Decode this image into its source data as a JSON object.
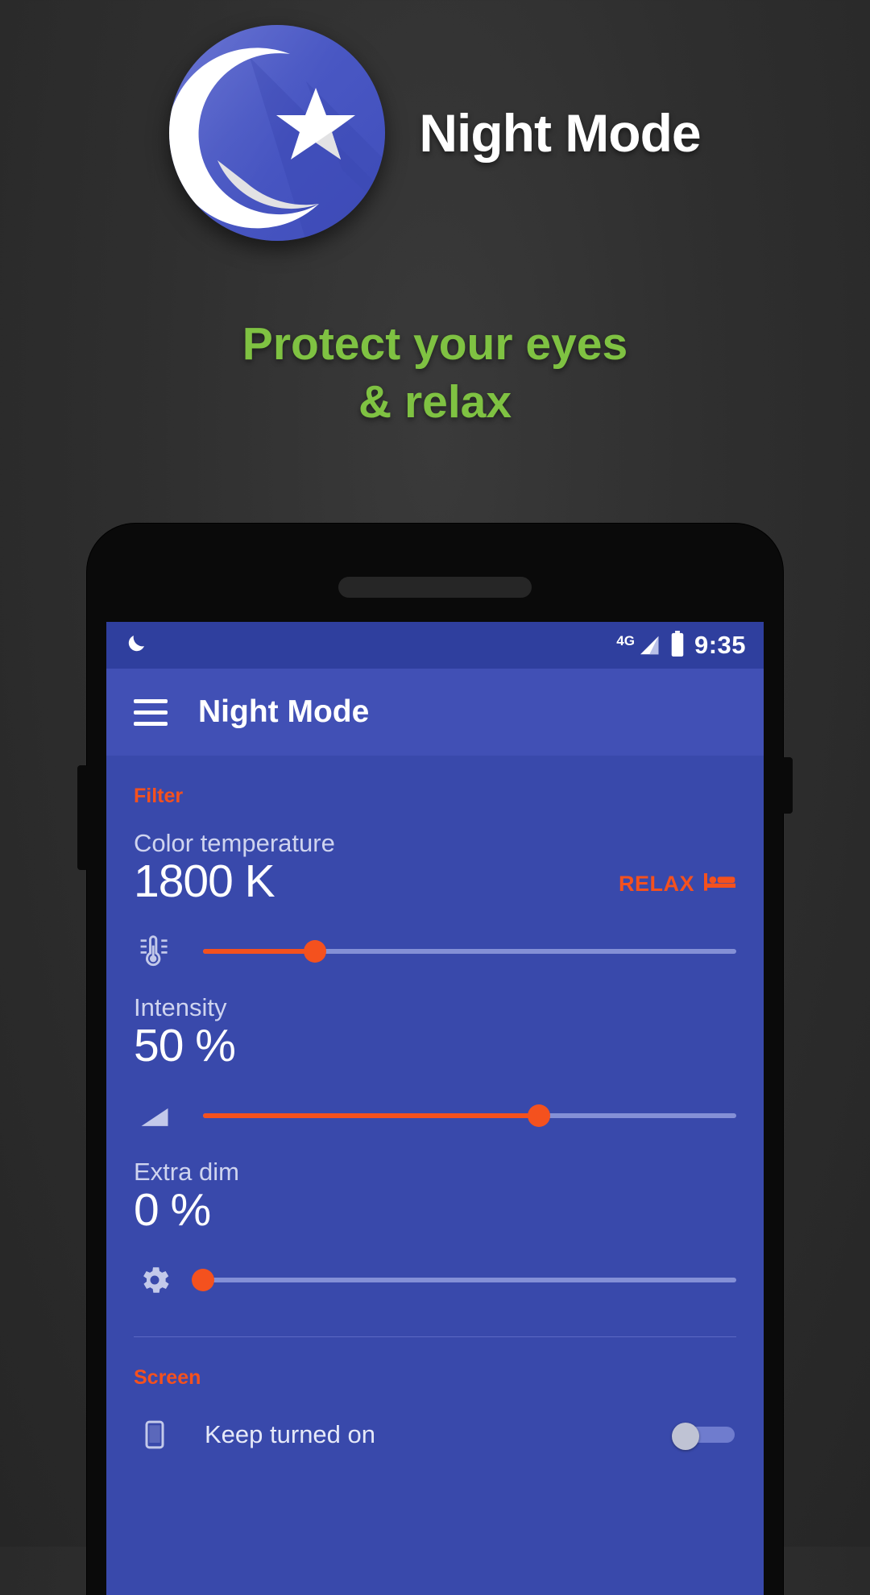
{
  "hero": {
    "title": "Night Mode",
    "icon_name": "moon-star-app-icon"
  },
  "tagline": {
    "line1": "Protect your eyes",
    "line2": "& relax",
    "color": "#7fc242"
  },
  "phone": {
    "statusbar": {
      "moon_icon": "crescent-moon-icon",
      "network": "4G",
      "battery_icon": "battery-icon",
      "time": "9:35"
    },
    "appbar": {
      "menu_icon": "hamburger-menu-icon",
      "title": "Night Mode"
    },
    "sections": [
      {
        "heading": "Filter",
        "color": "#f4511e",
        "rows": [
          {
            "label": "Color temperature",
            "value": "1800 K",
            "badge": "RELAX",
            "badge_icon": "bed-icon",
            "slider_icon": "thermometer-icon",
            "slider_percent": 21
          },
          {
            "label": "Intensity",
            "value": "50 %",
            "slider_icon": "brightness-triangle-icon",
            "slider_percent": 63
          },
          {
            "label": "Extra dim",
            "value": "0 %",
            "slider_icon": "gear-icon",
            "slider_percent": 0
          }
        ]
      },
      {
        "heading": "Screen",
        "color": "#f4511e",
        "toggles": [
          {
            "label": "Keep turned on",
            "icon": "phone-screen-icon",
            "state": "off"
          }
        ]
      }
    ]
  },
  "colors": {
    "background": "#2f2f2f",
    "accent_orange": "#f4511e",
    "app_blue": "#3949ab",
    "appbar_blue": "#4150b5",
    "statusbar_blue": "#2f3f9e",
    "green": "#7fc242"
  }
}
